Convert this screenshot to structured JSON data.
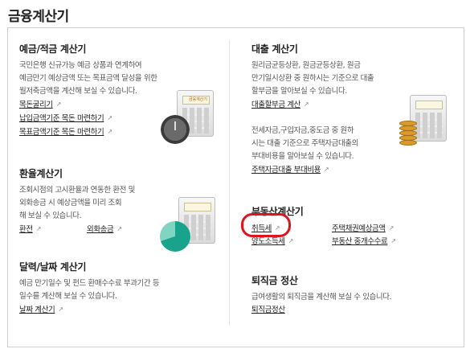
{
  "page_title": "금융계산기",
  "sections": {
    "savings": {
      "title": "예금/적금 계산기",
      "desc": [
        "국민은행 신규가능 예금 상품과 연계하여",
        "예금만기 예상금액 또는 목표금액 달성을 위한",
        "월저축금액을 계산해 보실 수 있습니다."
      ],
      "links": [
        "목돈굴리기",
        "납입금액기준 목돈 마련하기",
        "목표금액기준 목돈 마련하기"
      ]
    },
    "exchange": {
      "title": "환율계산기",
      "desc": [
        "조회시점의 고시환율과 연동한 환전 및",
        "외화송금 시 예상금액을 미리 조회",
        "해 보실 수 있습니다."
      ],
      "links": [
        "환전",
        "외화송금"
      ]
    },
    "date": {
      "title": "달력/날짜 계산기",
      "desc": [
        "예금 만기일수 및 펀드 환매수수료 부과기간 등",
        "일수를 계산해 보실 수 있습니다."
      ],
      "links": [
        "날짜 계산기"
      ]
    },
    "loan": {
      "title": "대출 계산기",
      "desc": [
        "원리금균등상환, 원금균등상환, 원금",
        "만기일시상환 중 원하시는 기준으로 대출",
        "할부금을 알아보실 수 있습니다."
      ],
      "links": [
        "대출할부금 계산"
      ],
      "desc2": [
        "전세자금,구입자금,중도금 중 원하",
        "시는 대출 기준으로 주택자금대출의",
        "부대비용을 알아보실 수 있습니다."
      ],
      "links2": [
        "주택자금대출 부대비용"
      ]
    },
    "realestate": {
      "title": "부동산계산기",
      "links": [
        "취득세",
        "주택채권예상금액",
        "양도소득세",
        "부동산 중개수수료"
      ]
    },
    "severance": {
      "title": "퇴직금 정산",
      "desc": [
        "급여생활의 퇴직금을 계산해 보실 수 있습니다."
      ],
      "links": [
        "퇴직금정산"
      ]
    }
  },
  "ext_icon": "↗",
  "calc_screen_text": "금융계산기",
  "colors": {
    "highlight": "#e0121b",
    "pie": "#1aa38c",
    "coin": "#d99b2b"
  }
}
